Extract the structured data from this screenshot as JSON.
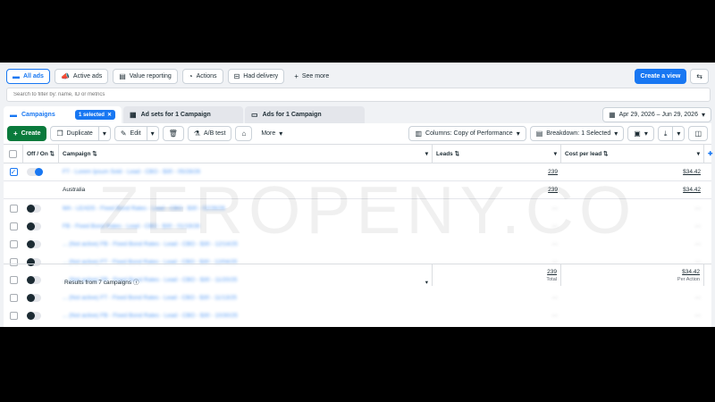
{
  "top_bar": {
    "all_ads": "All ads",
    "active_ads": "Active ads",
    "value_reporting": "Value reporting",
    "actions": "Actions",
    "had_delivery": "Had delivery",
    "see_more": "See more",
    "create_view": "Create a view"
  },
  "search": {
    "placeholder": "Search to filter by: name, ID or metrics"
  },
  "tabs": {
    "campaigns": "Campaigns",
    "selected_chip": "1 selected",
    "ad_sets": "Ad sets for 1 Campaign",
    "ads": "Ads for 1 Campaign",
    "date_range": "Apr 29, 2026 – Jun 29, 2026"
  },
  "toolbar": {
    "create": "Create",
    "duplicate": "Duplicate",
    "edit": "Edit",
    "ab_test": "A/B test",
    "more": "More",
    "columns": "Columns: Copy of Performance",
    "breakdown": "Breakdown: 1 Selected"
  },
  "table": {
    "headers": {
      "off_on": "Off / On",
      "campaign": "Campaign",
      "leads": "Leads",
      "cost_per_lead": "Cost per lead"
    },
    "selected_row": {
      "campaign": "FT - Lorem Ipsum Sold - Lead - CBO - $30 - 05/28/26",
      "leads": "239",
      "cost": "$34.42"
    },
    "breakdown_row": {
      "campaign": "Australia",
      "leads": "239",
      "cost": "$34.42"
    },
    "rows": [
      {
        "campaign": "MA - LEADS - Fixed Bond Rates - Lead - CBO - $30 - 02/26/26",
        "leads": "—",
        "cost": "—"
      },
      {
        "campaign": "FB - Fixed Bond Rates - Lead - CBO - $30 - 01/19/26",
        "leads": "—",
        "cost": "—"
      },
      {
        "campaign": "... (Not active) FB - Fixed Bond Rates - Lead - CBO - $30 - 12/14/25",
        "leads": "—",
        "cost": "—"
      },
      {
        "campaign": "... (Not active) FT - Fixed Bond Rates - Lead - CBO - $30 - 12/04/25",
        "leads": "—",
        "cost": "—"
      },
      {
        "campaign": "... (Not active) FB - Fixed Bond Rates - Lead - CBO - $30 - 11/20/25",
        "leads": "—",
        "cost": "—"
      },
      {
        "campaign": "... (Not active) FT - Fixed Bond Rates - Lead - CBO - $30 - 11/13/25",
        "leads": "—",
        "cost": "—"
      },
      {
        "campaign": "... (Not active) FB - Fixed Bond Rates - Lead - CBO - $30 - 10/30/25",
        "leads": "—",
        "cost": "—"
      }
    ],
    "totals": {
      "label": "Results from 7 campaigns",
      "leads": "239",
      "leads_sub": "Total",
      "cost": "$34.42",
      "cost_sub": "Per Action"
    }
  },
  "watermark": "ZEROPENY.CO",
  "colors": {
    "accent": "#1877f2",
    "create_green": "#0a7a3c",
    "background": "#f0f2f5"
  }
}
